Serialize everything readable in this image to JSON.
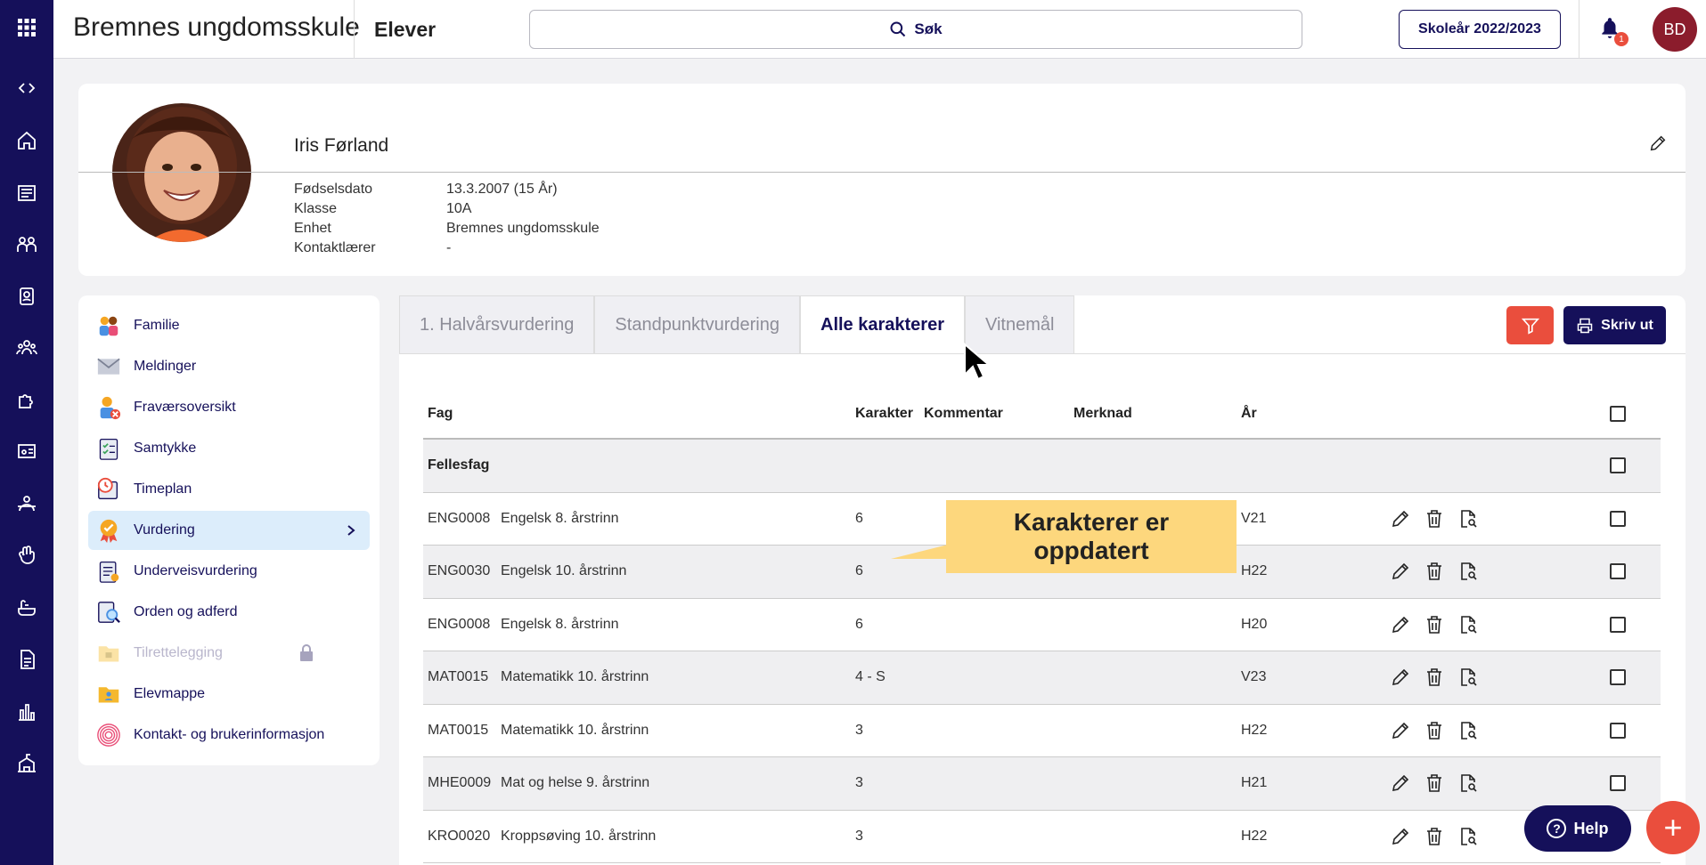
{
  "topbar": {
    "school": "Bremnes ungdomsskule",
    "section": "Elever",
    "search_label": "Søk",
    "year_button": "Skoleår 2022/2023",
    "notification_count": "1",
    "user_initials": "BD"
  },
  "profile": {
    "name": "Iris Førland",
    "fields": [
      {
        "label": "Fødselsdato",
        "value": "13.3.2007 (15 År)"
      },
      {
        "label": "Klasse",
        "value": "10A"
      },
      {
        "label": "Enhet",
        "value": "Bremnes ungdomsskule"
      },
      {
        "label": "Kontaktlærer",
        "value": "-"
      }
    ]
  },
  "menu": {
    "items": [
      {
        "label": "Familie",
        "icon": "family-icon"
      },
      {
        "label": "Meldinger",
        "icon": "envelope-icon"
      },
      {
        "label": "Fraværsoversikt",
        "icon": "absence-icon"
      },
      {
        "label": "Samtykke",
        "icon": "clipboard-check-icon"
      },
      {
        "label": "Timeplan",
        "icon": "calendar-clock-icon"
      },
      {
        "label": "Vurdering",
        "icon": "medal-icon",
        "active": true
      },
      {
        "label": "Underveisvurdering",
        "icon": "clipboard-medal-icon"
      },
      {
        "label": "Orden og adferd",
        "icon": "document-search-icon"
      },
      {
        "label": "Tilrettelegging",
        "icon": "locked-folder-icon",
        "disabled": true
      },
      {
        "label": "Elevmappe",
        "icon": "student-folder-icon"
      },
      {
        "label": "Kontakt- og brukerinformasjon",
        "icon": "fingerprint-icon"
      }
    ]
  },
  "tabs": [
    "1. Halvårsvurdering",
    "Standpunktvurdering",
    "Alle karakterer",
    "Vitnemål"
  ],
  "active_tab": "Alle karakterer",
  "print_label": "Skriv ut",
  "table": {
    "headers": {
      "fag": "Fag",
      "karakter": "Karakter",
      "kommentar": "Kommentar",
      "merknad": "Merknad",
      "aar": "År"
    },
    "group": "Fellesfag",
    "rows": [
      {
        "code": "ENG0008",
        "name": "Engelsk 8. årstrinn",
        "grade": "6",
        "year": "V21"
      },
      {
        "code": "ENG0030",
        "name": "Engelsk 10. årstrinn",
        "grade": "6",
        "year": "H22"
      },
      {
        "code": "ENG0008",
        "name": "Engelsk 8. årstrinn",
        "grade": "6",
        "year": "H20"
      },
      {
        "code": "MAT0015",
        "name": "Matematikk 10. årstrinn",
        "grade": "4 - S",
        "year": "V23"
      },
      {
        "code": "MAT0015",
        "name": "Matematikk 10. årstrinn",
        "grade": "3",
        "year": "H22"
      },
      {
        "code": "MHE0009",
        "name": "Mat og helse 9. årstrinn",
        "grade": "3",
        "year": "H21"
      },
      {
        "code": "KRO0020",
        "name": "Kroppsøving 10. årstrinn",
        "grade": "3",
        "year": "H22"
      }
    ]
  },
  "tooltip": {
    "line1": "Karakterer er",
    "line2": "oppdatert"
  },
  "help_label": "Help",
  "colors": {
    "navy": "#15105a",
    "red": "#ea4e3d",
    "tooltip": "#fdd77d",
    "active_menu": "#dcedfb"
  }
}
